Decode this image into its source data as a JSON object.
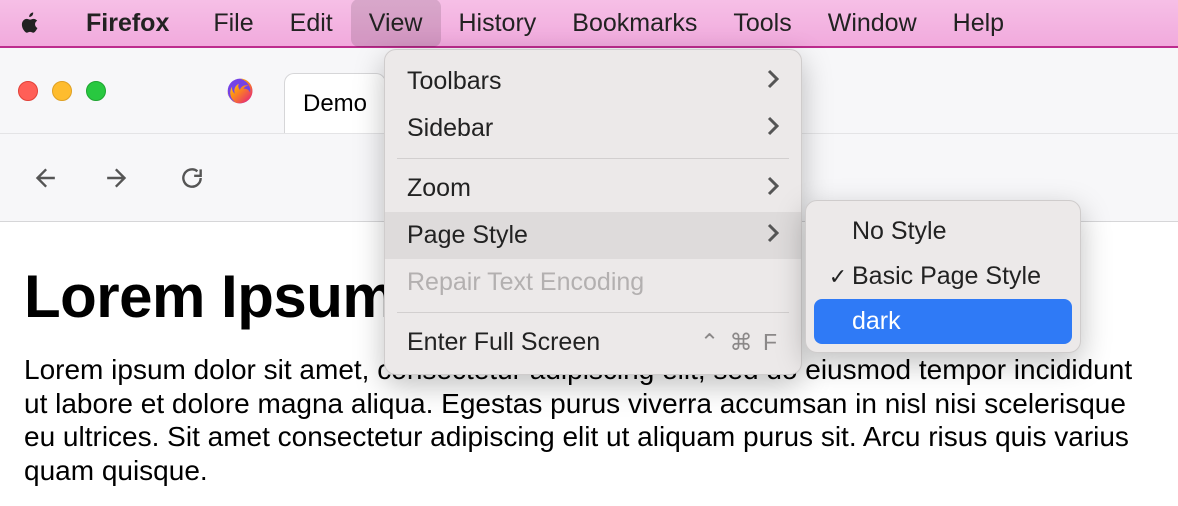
{
  "menubar": {
    "app_name": "Firefox",
    "items": [
      "File",
      "Edit",
      "View",
      "History",
      "Bookmarks",
      "Tools",
      "Window",
      "Help"
    ],
    "active_index": 2
  },
  "browser": {
    "tab_title": "Demo"
  },
  "view_menu": {
    "toolbars": "Toolbars",
    "sidebar": "Sidebar",
    "zoom": "Zoom",
    "page_style": "Page Style",
    "repair": "Repair Text Encoding",
    "fullscreen": "Enter Full Screen",
    "fullscreen_shortcut": "⌃ ⌘ F"
  },
  "page_style_submenu": {
    "no_style": "No Style",
    "basic": "Basic Page Style",
    "dark": "dark",
    "checked_index": 1,
    "highlighted_index": 2
  },
  "page": {
    "heading": "Lorem Ipsum",
    "body": "Lorem ipsum dolor sit amet, consectetur adipiscing elit, sed do eiusmod tempor incididunt ut labore et dolore magna aliqua. Egestas purus viverra accumsan in nisl nisi scelerisque eu ultrices. Sit amet consectetur adipiscing elit ut aliquam purus sit. Arcu risus quis varius quam quisque."
  }
}
